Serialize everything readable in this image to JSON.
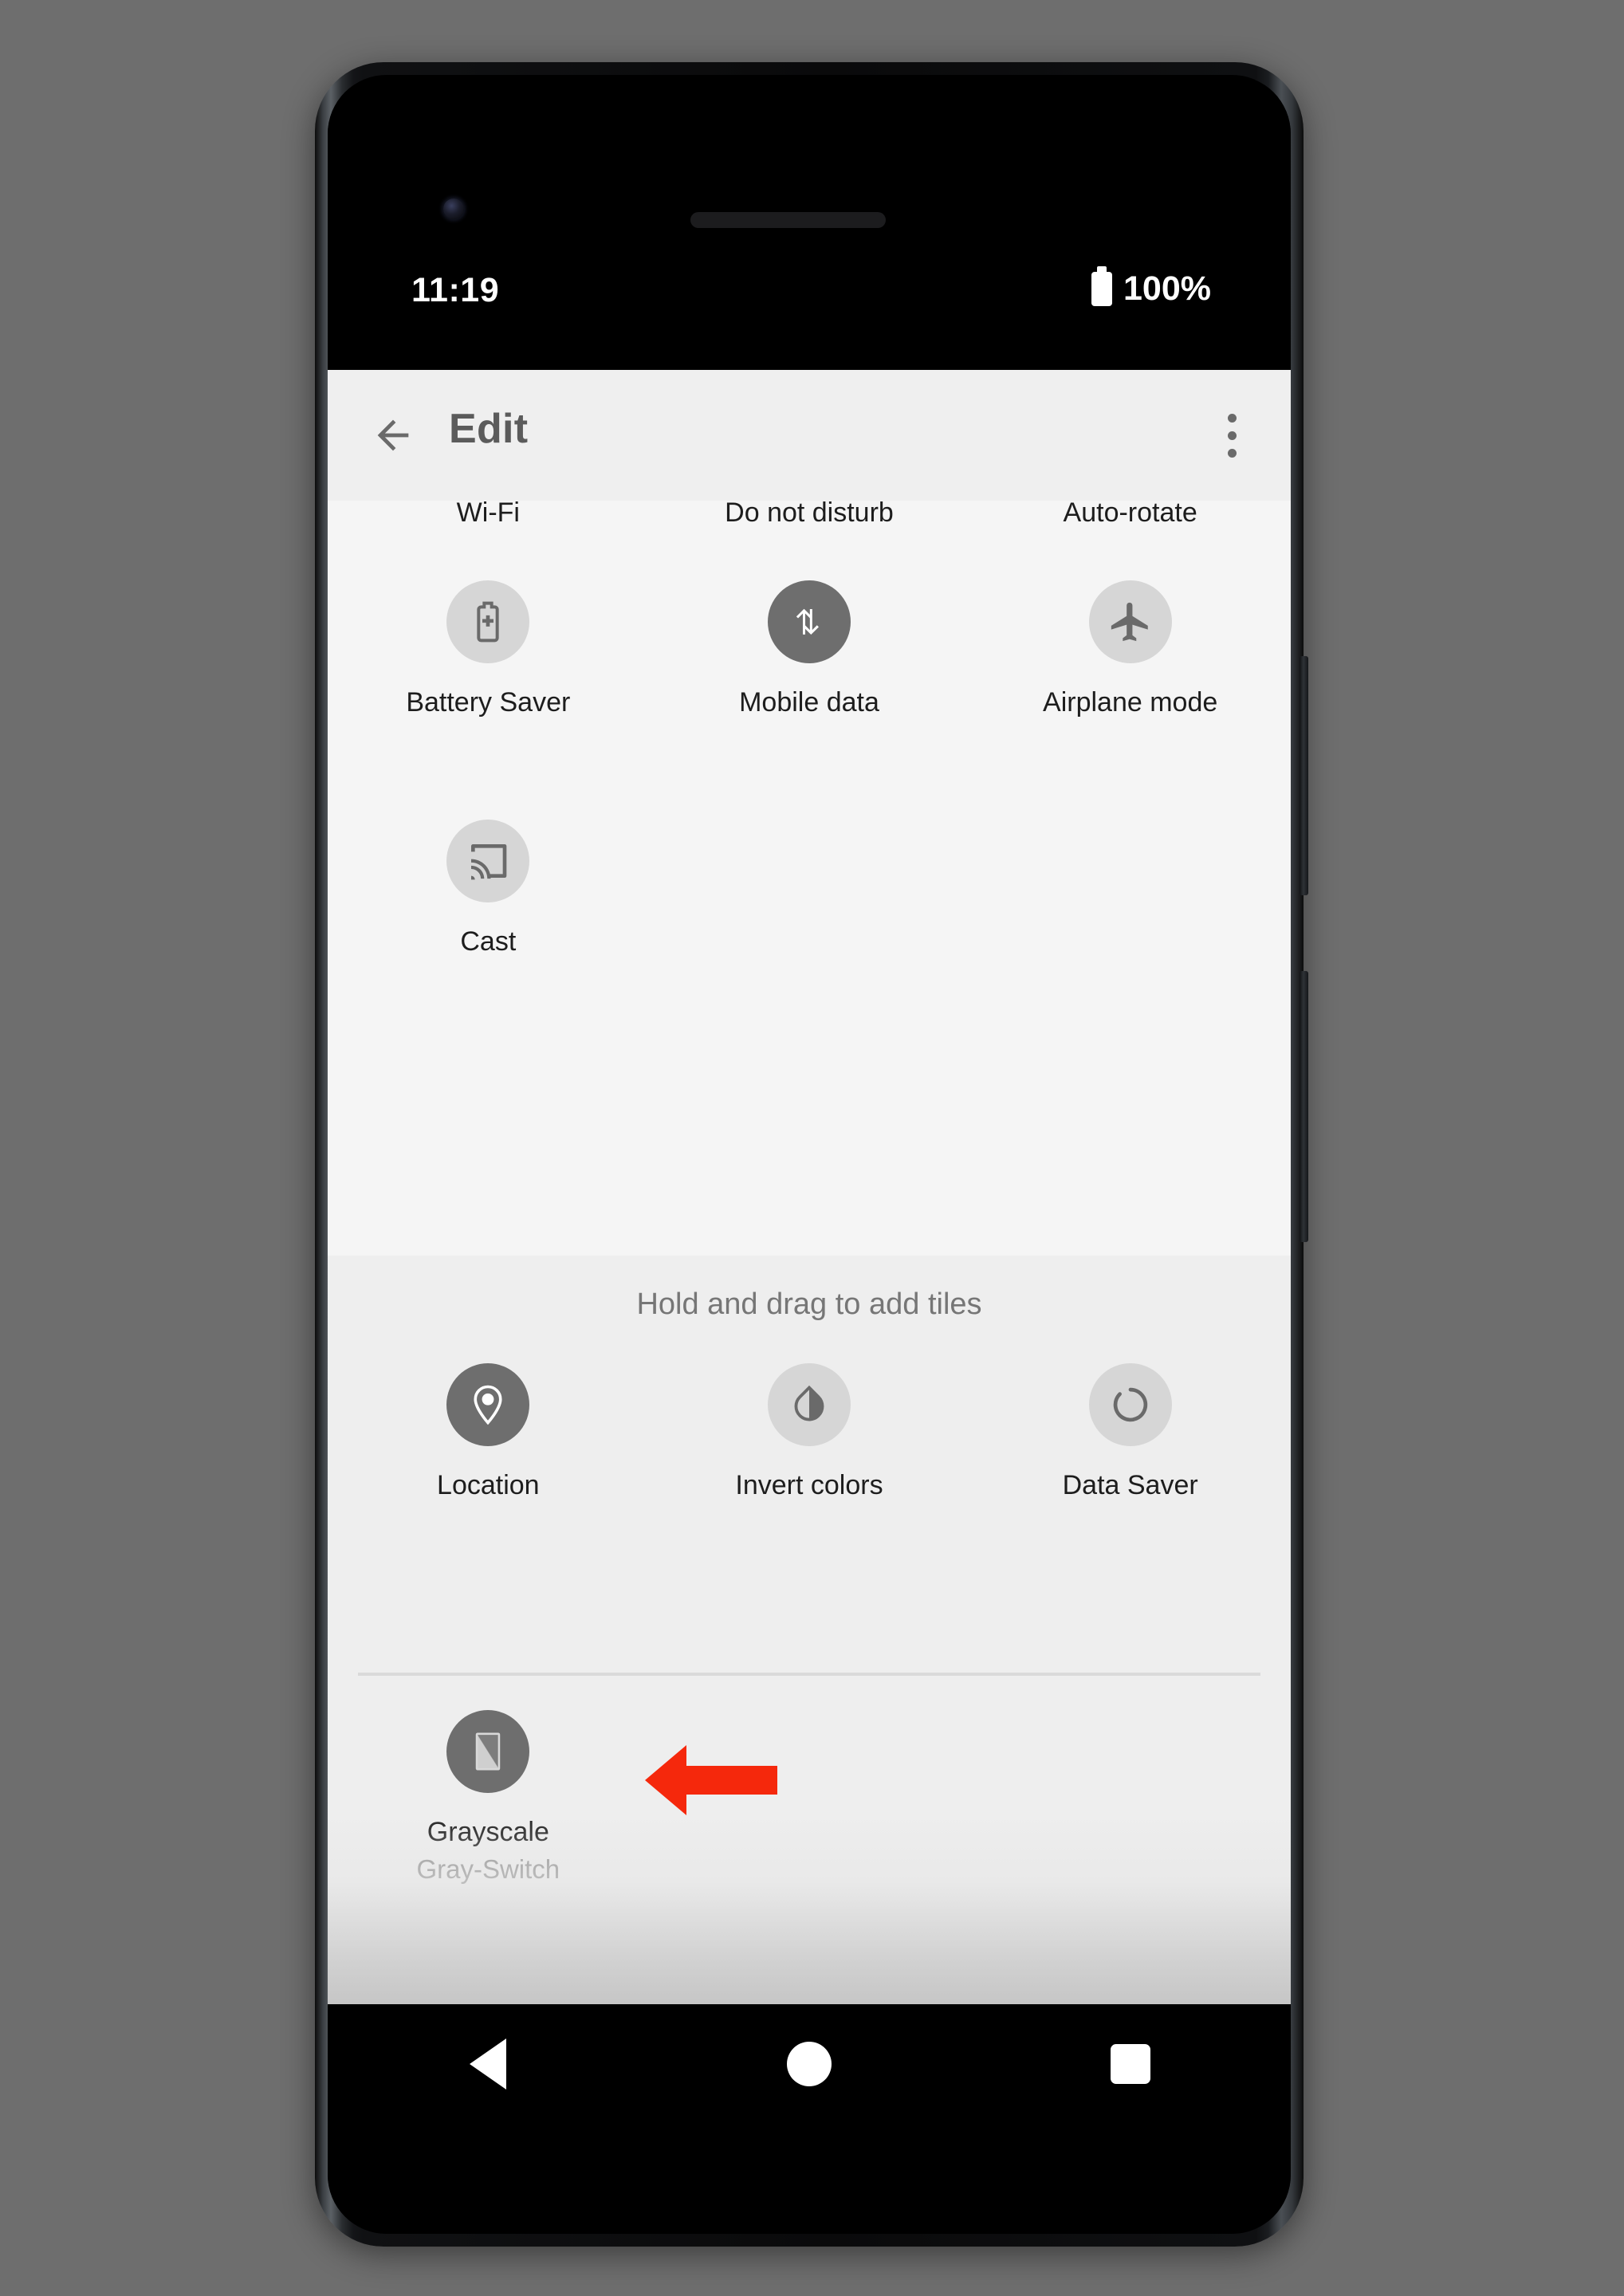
{
  "device": {
    "status_bar": {
      "time": "11:19",
      "battery_percent": "100%",
      "battery_icon": "battery-full-icon"
    },
    "nav_bar": {
      "back": "nav-back-triangle-icon",
      "home": "nav-home-circle-icon",
      "recents": "nav-recents-square-icon"
    },
    "hardware": {
      "camera": "front-camera-icon",
      "speaker": "earpiece-speaker",
      "power_button": "power-button",
      "volume_button": "volume-rocker-button"
    }
  },
  "app_bar": {
    "back_icon": "arrow-left-icon",
    "title": "Edit",
    "overflow_icon": "more-vertical-icon"
  },
  "current_tiles": {
    "clipped_row_labels": [
      "Wi-Fi",
      "Do not disturb",
      "Auto-rotate"
    ],
    "tiles": [
      {
        "label": "Battery Saver",
        "icon": "battery-saver-icon",
        "state": "inactive"
      },
      {
        "label": "Mobile data",
        "icon": "mobile-data-icon",
        "state": "active"
      },
      {
        "label": "Airplane mode",
        "icon": "airplane-icon",
        "state": "inactive"
      },
      {
        "label": "Cast",
        "icon": "cast-icon",
        "state": "inactive"
      }
    ]
  },
  "add_tiles": {
    "heading": "Hold and drag to add tiles",
    "tiles": [
      {
        "label": "Location",
        "icon": "location-pin-icon",
        "state": "active"
      },
      {
        "label": "Invert colors",
        "icon": "invert-colors-icon",
        "state": "inactive"
      },
      {
        "label": "Data Saver",
        "icon": "data-saver-icon",
        "state": "inactive"
      }
    ],
    "custom_tile": {
      "label": "Grayscale",
      "sublabel": "Gray-Switch",
      "icon": "grayscale-tile-icon",
      "state": "active"
    }
  },
  "annotation": {
    "arrow": "left-pointing-arrow",
    "color": "#f5280c"
  },
  "colors": {
    "backdrop": "#6e6e6e",
    "app_bar_bg": "#efefef",
    "current_section_bg": "#f5f5f5",
    "add_section_bg": "#eeeeee",
    "tile_inactive": "#d6d6d6",
    "tile_active": "#6e6e6e",
    "title_text": "#5b5b5b",
    "label_text": "#1d1d1d",
    "sublabel_text": "#8c8c8c",
    "heading_text": "#767676",
    "divider": "#dadada",
    "nav_bar_bg": "#000000"
  }
}
